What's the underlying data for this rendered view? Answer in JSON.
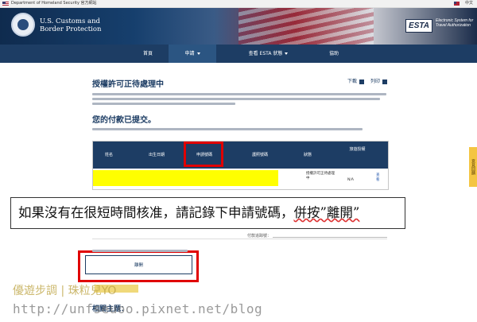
{
  "gov_bar": {
    "site": "Department of Homeland Security 官方網站",
    "language": "中文"
  },
  "header": {
    "agency_line1": "U.S. Customs and",
    "agency_line2": "Border Protection",
    "esta_logo": "ESTA",
    "esta_line1": "Electronic System for",
    "esta_line2": "Travel Authorization"
  },
  "nav": {
    "items": [
      {
        "label": "首頁"
      },
      {
        "label": "申請"
      },
      {
        "label": "查看 ESTA 狀態"
      },
      {
        "label": "協助"
      }
    ]
  },
  "main": {
    "title": "授權許可正待處理中",
    "download_label": "下載",
    "print_label": "列印",
    "subtitle": "您的付款已提交。",
    "table": {
      "headers": [
        "姓名",
        "出生日期",
        "申請號碼",
        "護照號碼",
        "狀態",
        "旅遊授權"
      ],
      "row": {
        "status": "授權許可正待處理中",
        "travel": "N/A",
        "action": "查看"
      }
    },
    "reference_label": "付款追踪號：",
    "leave_button": "離開",
    "related_title": "相關主題："
  },
  "side_tab": {
    "label": "意見回饋"
  },
  "annotation": {
    "caption_prefix": "如果沒有在很短時間核准，請記錄下申請號碼，",
    "caption_suffix": "併按”離開”"
  },
  "watermark": {
    "line1": "優遊步調 | 珠粒兒YO",
    "line2": "http://unfseuoo.pixnet.net/blog"
  },
  "colors": {
    "navy": "#1d3d64",
    "highlight": "#ffff00",
    "annotation_red": "#e00000"
  }
}
